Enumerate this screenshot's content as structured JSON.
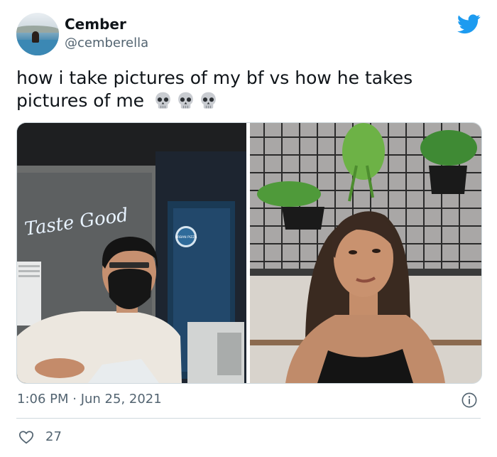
{
  "header": {
    "display_name": "Cember",
    "handle": "@cemberella",
    "avatar_icon": "profile-avatar",
    "logo_icon": "twitter-bird-icon",
    "brand_color": "#1d9bf0"
  },
  "tweet": {
    "text_line1": "how i take pictures of my bf vs how he takes",
    "text_line2": "pictures of me",
    "emoji": [
      "💀",
      "💀",
      "💀"
    ],
    "emoji_icon": "skull-emoji-icon"
  },
  "media": {
    "photos": [
      {
        "neon_sign": "Taste Good",
        "badge": "URBAN PIZZA"
      },
      {}
    ]
  },
  "footer": {
    "timestamp": "1:06 PM · Jun 25, 2021",
    "likes": "27",
    "info_icon": "info-icon",
    "heart_icon": "heart-icon"
  },
  "colors": {
    "text_primary": "#0f1419",
    "text_secondary": "#536471",
    "border": "#cfd9de"
  }
}
